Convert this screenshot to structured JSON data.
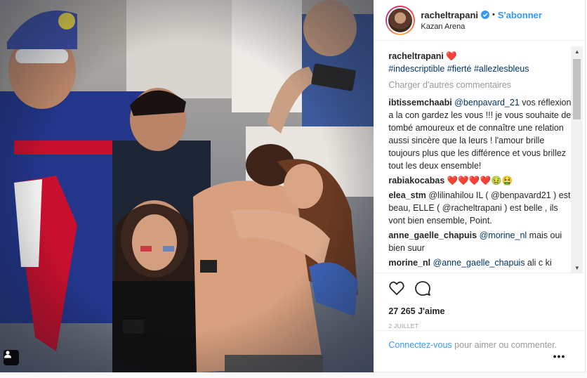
{
  "header": {
    "username": "racheltrapani",
    "follow_separator": "•",
    "follow_label": "S'abonner",
    "location": "Kazan Arena"
  },
  "caption": {
    "username": "racheltrapani",
    "emoji": "❤️",
    "hashtags": "#indescriptible #fierté #allezlesbleus"
  },
  "load_more_label": "Charger d'autres commentaires",
  "comments": [
    {
      "user": "ibtissemchaabi",
      "mention": "@benpavard_21",
      "text": " vos réflexions a la con gardez les vous !!! je vous souhaite de tombé amoureux et de connaître une relation aussi sincère que la leurs ! l'amour brille toujours plus que les différence et vous brillez tout les deux ensemble!"
    },
    {
      "user": "rabiakocabas",
      "text": " ❤️❤️❤️❤️🤢🤮"
    },
    {
      "user": "elea_stm",
      "text": " @lilinahilou IL ( @benpavard21 ) est beau, ELLE ( @racheltrapani ) est belle , ils vont bien ensemble, Point."
    },
    {
      "user": "anne_gaelle_chapuis",
      "mention": "@morine_nl",
      "text": " mais oui bien suur"
    },
    {
      "user": "morine_nl",
      "mention": "@anne_gaelle_chapuis",
      "text": " ali c ki"
    }
  ],
  "likes": "27 265 J'aime",
  "date": "2 JUILLET",
  "login": {
    "link": "Connectez-vous",
    "text": " pour aimer ou commenter."
  },
  "more_label": "•••",
  "icons": {
    "like": "heart-icon",
    "comment": "comment-icon",
    "verified": "verified-badge-icon",
    "tag": "tagged-people-icon"
  },
  "colors": {
    "link_blue": "#3897f0",
    "mention_blue": "#003569",
    "muted": "#999999",
    "verified": "#3897f0"
  }
}
